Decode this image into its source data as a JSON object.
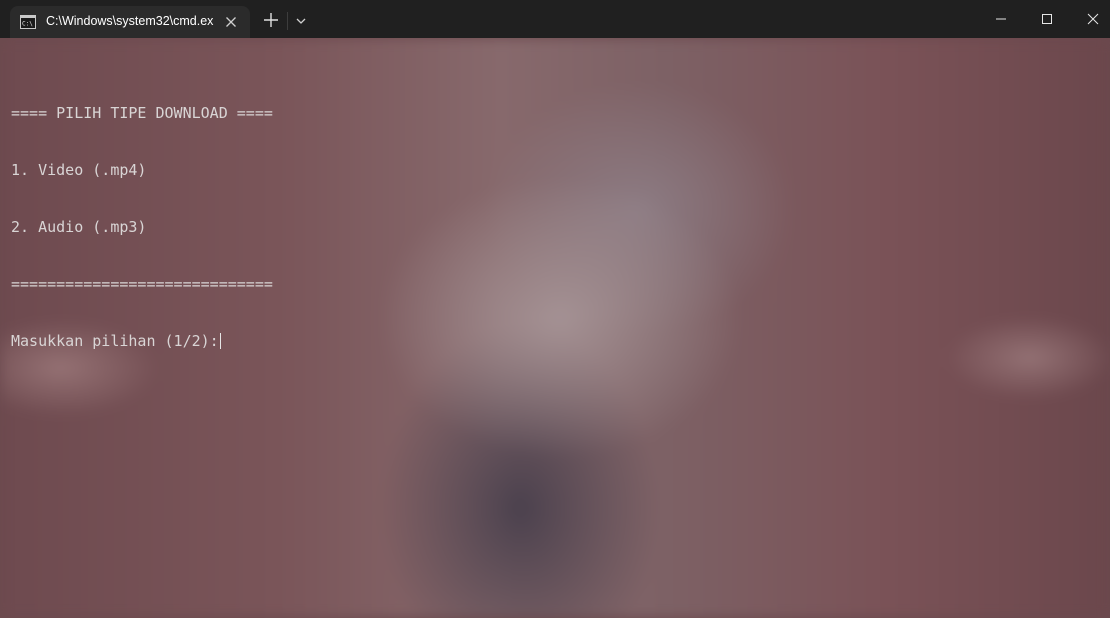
{
  "tab": {
    "title": "C:\\Windows\\system32\\cmd.ex",
    "icon": "cmd-icon"
  },
  "toolbar": {
    "new_tab_icon": "plus-icon",
    "dropdown_icon": "chevron-down-icon"
  },
  "window_controls": {
    "minimize_icon": "minimize-icon",
    "maximize_icon": "maximize-icon",
    "close_icon": "close-icon"
  },
  "console": {
    "lines": [
      "==== PILIH TIPE DOWNLOAD ====",
      "1. Video (.mp4)",
      "2. Audio (.mp3)",
      "============================="
    ],
    "prompt": "Masukkan pilihan (1/2):"
  },
  "colors": {
    "titlebar": "#202020",
    "tab": "#2b2b2b",
    "text": "#d9d5d5"
  }
}
